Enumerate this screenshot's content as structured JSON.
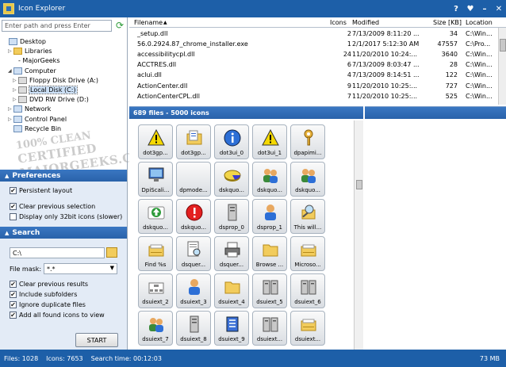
{
  "window": {
    "title": "Icon Explorer",
    "buttons": [
      "?",
      "♥",
      "–",
      "✕"
    ]
  },
  "left": {
    "path_placeholder": "Enter path and press Enter",
    "tree": [
      {
        "label": "Desktop",
        "indent": 0,
        "exp": "",
        "icon": "desktop"
      },
      {
        "label": "Libraries",
        "indent": 1,
        "exp": "▷",
        "icon": "folder"
      },
      {
        "label": "- MajorGeeks",
        "indent": 2,
        "exp": "",
        "icon": "none"
      },
      {
        "label": "Computer",
        "indent": 1,
        "exp": "◢",
        "icon": "computer"
      },
      {
        "label": "Floppy Disk Drive (A:)",
        "indent": 2,
        "exp": "▷",
        "icon": "drive"
      },
      {
        "label": "Local Disk (C:)",
        "indent": 2,
        "exp": "▷",
        "icon": "drive",
        "selected": true
      },
      {
        "label": "DVD RW Drive (D:)",
        "indent": 2,
        "exp": "▷",
        "icon": "drive"
      },
      {
        "label": "Network",
        "indent": 1,
        "exp": "▷",
        "icon": "computer"
      },
      {
        "label": "Control Panel",
        "indent": 1,
        "exp": "▷",
        "icon": "computer"
      },
      {
        "label": "Recycle Bin",
        "indent": 1,
        "exp": "",
        "icon": "computer"
      }
    ],
    "watermark": {
      "line1": "100% CLEAN",
      "line2": "CERTIFIED",
      "line3": "MAJORGEEKS",
      "line4": ".COM"
    },
    "preferences": {
      "title": "Preferences",
      "options": [
        {
          "label": "Persistent layout",
          "checked": true
        },
        {
          "label": "Clear previous selection",
          "checked": true
        },
        {
          "label": "Display only 32bit icons (slower)",
          "checked": false
        }
      ]
    },
    "search": {
      "title": "Search",
      "path_value": "C:\\",
      "mask_label": "File mask:",
      "mask_value": "*.*",
      "options": [
        {
          "label": "Clear previous results",
          "checked": true
        },
        {
          "label": "Include subfolders",
          "checked": true
        },
        {
          "label": "Ignore duplicate files",
          "checked": true
        },
        {
          "label": "Add all found icons to view",
          "checked": true
        }
      ],
      "start_label": "START"
    }
  },
  "filelist": {
    "columns": {
      "filename": "Filename",
      "icons": "Icons",
      "modified": "Modified",
      "size": "Size [KB]",
      "location": "Location"
    },
    "rows": [
      {
        "filename": "_setup.dll",
        "icons": "2",
        "modified": "7/13/2009 8:11:20 ...",
        "size": "34",
        "location": "C:\\Win..."
      },
      {
        "filename": "56.0.2924.87_chrome_installer.exe",
        "icons": "1",
        "modified": "2/1/2017 5:12:30 AM",
        "size": "47557",
        "location": "C:\\Pro..."
      },
      {
        "filename": "accessibilitycpl.dll",
        "icons": "24",
        "modified": "11/20/2010 10:24:...",
        "size": "3640",
        "location": "C:\\Win..."
      },
      {
        "filename": "ACCTRES.dll",
        "icons": "6",
        "modified": "7/13/2009 8:03:47 ...",
        "size": "28",
        "location": "C:\\Win..."
      },
      {
        "filename": "aclui.dll",
        "icons": "4",
        "modified": "7/13/2009 8:14:51 ...",
        "size": "122",
        "location": "C:\\Win..."
      },
      {
        "filename": "ActionCenter.dll",
        "icons": "9",
        "modified": "11/20/2010 10:25:...",
        "size": "727",
        "location": "C:\\Win..."
      },
      {
        "filename": "ActionCenterCPL.dll",
        "icons": "7",
        "modified": "11/20/2010 10:25:...",
        "size": "525",
        "location": "C:\\Win..."
      }
    ]
  },
  "icons": {
    "header": "689 files - 5000 icons",
    "tiles": [
      {
        "label": "dot3gp...",
        "icon": "warning"
      },
      {
        "label": "dot3gp...",
        "icon": "folder-doc"
      },
      {
        "label": "dot3ui_0",
        "icon": "info"
      },
      {
        "label": "dot3ui_1",
        "icon": "warning"
      },
      {
        "label": "dpapimi...",
        "icon": "key"
      },
      {
        "label": "DpiScali...",
        "icon": "monitor"
      },
      {
        "label": "dpmode...",
        "icon": "blank"
      },
      {
        "label": "dskquo...",
        "icon": "pie"
      },
      {
        "label": "dskquo...",
        "icon": "users"
      },
      {
        "label": "dskquo...",
        "icon": "users"
      },
      {
        "label": "dskquo...",
        "icon": "up-arrow"
      },
      {
        "label": "dskquo...",
        "icon": "error"
      },
      {
        "label": "dsprop_0",
        "icon": "server"
      },
      {
        "label": "dsprop_1",
        "icon": "user"
      },
      {
        "label": "This will...",
        "icon": "find"
      },
      {
        "label": "Find %s",
        "icon": "folder-find"
      },
      {
        "label": "dsquer...",
        "icon": "doc-find"
      },
      {
        "label": "dsquer...",
        "icon": "printer"
      },
      {
        "label": "Browse ...",
        "icon": "folder"
      },
      {
        "label": "Microso...",
        "icon": "folder-find"
      },
      {
        "label": "dsuiext_2",
        "icon": "org"
      },
      {
        "label": "dsuiext_3",
        "icon": "user"
      },
      {
        "label": "dsuiext_4",
        "icon": "folder"
      },
      {
        "label": "dsuiext_5",
        "icon": "servers"
      },
      {
        "label": "dsuiext_6",
        "icon": "servers"
      },
      {
        "label": "dsuiext_7",
        "icon": "users"
      },
      {
        "label": "dsuiext_8",
        "icon": "server"
      },
      {
        "label": "dsuiext_9",
        "icon": "blue-box"
      },
      {
        "label": "dsuiext...",
        "icon": "servers"
      },
      {
        "label": "dsuiext...",
        "icon": "folder-find"
      }
    ]
  },
  "status": {
    "files": "Files: 1028",
    "icons": "Icons: 7653",
    "search_time": "Search time: 00:12:03",
    "memory": "73 MB"
  },
  "colors": {
    "titlebar": "#1d5fa8",
    "section_header": "#2f6ab5",
    "panel_bg": "#e3ebf6"
  }
}
